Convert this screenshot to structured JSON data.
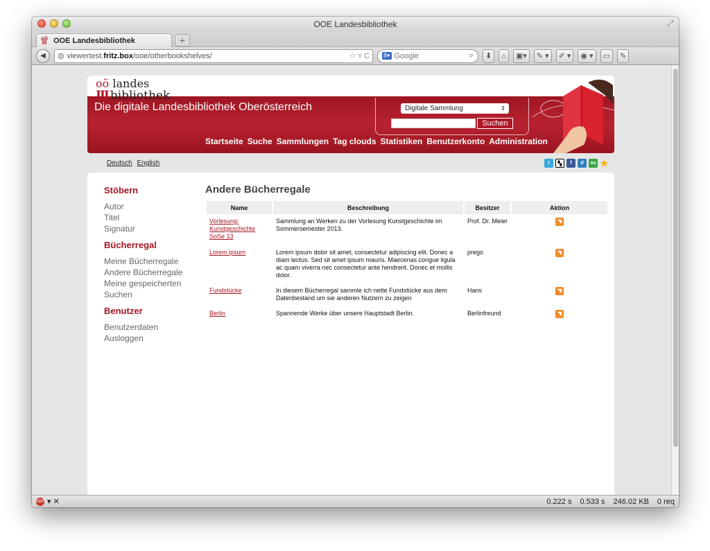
{
  "window": {
    "title": "OOE Landesbibliothek",
    "tab_title": "OOE Landesbibliothek",
    "url_prefix": "viewertest.",
    "url_host": "fritz.box",
    "url_path": "/ooe/otherbookshelves/",
    "search_engine": "Google"
  },
  "site": {
    "logo_line1_a": "oö",
    "logo_line1_b": "landes",
    "logo_line2": "bibliothek",
    "title": "Die digitale Landesbibliothek Oberösterreich",
    "search_select": "Digitale Sammlung",
    "search_button": "Suchen",
    "nav": [
      "Startseite",
      "Suche",
      "Sammlungen",
      "Tag clouds",
      "Statistiken",
      "Benutzerkonto",
      "Administration"
    ],
    "languages": [
      "Deutsch",
      "English"
    ]
  },
  "sidebar": {
    "sections": [
      {
        "title": "Stöbern",
        "links": [
          "Autor",
          "Titel",
          "Signatur"
        ]
      },
      {
        "title": "Bücherregal",
        "links": [
          "Meine Bücherregale",
          "Andere Bücherregale",
          "Meine gespeicherten Suchen"
        ]
      },
      {
        "title": "Benutzer",
        "links": [
          "Benutzerdaten",
          "Ausloggen"
        ]
      }
    ]
  },
  "main": {
    "heading": "Andere Bücherregale",
    "columns": [
      "Name",
      "Beschreibung",
      "Besitzer",
      "Aktion"
    ],
    "rows": [
      {
        "name": "Vorlesung: Kunstgeschichte SoSe 13",
        "description": "Sammlung an Werken zu der Vorlesung Kunstgeschichte im Sommersemester 2013.",
        "owner": "Prof. Dr. Meier"
      },
      {
        "name": "Lorem ipsum",
        "description": "Lorem ipsum dolor sit amet, consectetur adipiscing elit. Donec a diam lectus. Sed sit amet ipsum mauris. Maecenas congue ligula ac quam viverra nec consectetur ante hendrerit. Donec et mollis dolor.",
        "owner": "prego"
      },
      {
        "name": "Fundstücke",
        "description": "In diesem Bücherregal sammle ich nette Fundstücke aus dem Datenbestand um sie anderen Nutzern zu zeigen",
        "owner": "Hans"
      },
      {
        "name": "Berlin",
        "description": "Spannende Werke über unsere Hauptstadt Berlin.",
        "owner": "Berlinfreund"
      }
    ]
  },
  "statusbar": {
    "time1": "0.222 s",
    "time2": "0.533 s",
    "size": "246.02 KB",
    "requests": "0 req"
  }
}
